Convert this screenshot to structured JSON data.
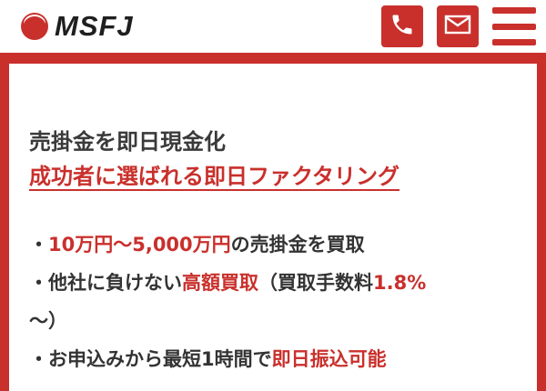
{
  "header": {
    "logo_text": "MSFJ",
    "phone_icon": "phone-icon",
    "mail_icon": "mail-icon",
    "menu_icon": "hamburger-menu-icon"
  },
  "colors": {
    "accent": "#c9302c",
    "text": "#333333"
  },
  "main": {
    "lead": "売掛金を即日現金化",
    "headline": "成功者に選ばれる即日ファクタリング",
    "features": [
      {
        "bullet": "・",
        "pre": "",
        "hl1": "10万円〜5,000万円",
        "mid": "の売掛金を買取",
        "hl2": "",
        "post": ""
      },
      {
        "bullet": "・",
        "pre": "他社に負けない",
        "hl1": "高額買取",
        "mid": "（買取手数料",
        "hl2": "1.8%",
        "post": "〜）"
      },
      {
        "bullet": "・",
        "pre": "お申込みから最短1時間で",
        "hl1": "即日振込可能",
        "mid": "",
        "hl2": "",
        "post": ""
      }
    ]
  }
}
